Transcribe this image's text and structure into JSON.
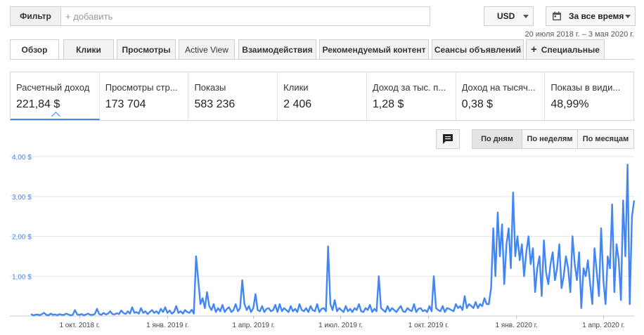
{
  "filter": {
    "button_label": "Фильтр",
    "placeholder": "+ добавить"
  },
  "currency": {
    "value": "USD"
  },
  "range": {
    "label": "За все время",
    "dates": "20 июля 2018 г. – 3 мая 2020 г."
  },
  "tabs": [
    {
      "label": "Обзор"
    },
    {
      "label": "Клики"
    },
    {
      "label": "Просмотры"
    },
    {
      "label": "Active View"
    },
    {
      "label": "Взаимодействия"
    },
    {
      "label": "Рекомендуемый контент"
    },
    {
      "label": "Сеансы объявлений"
    },
    {
      "label": "Специальные"
    }
  ],
  "metrics": [
    {
      "label": "Расчетный доход",
      "value": "221,84 $"
    },
    {
      "label": "Просмотры стр...",
      "value": "173 704"
    },
    {
      "label": "Показы",
      "value": "583 236"
    },
    {
      "label": "Клики",
      "value": "2 406"
    },
    {
      "label": "Доход за тыс. п...",
      "value": "1,28 $"
    },
    {
      "label": "Доход на тысяч...",
      "value": "0,38 $"
    },
    {
      "label": "Показы в види...",
      "value": "48,99%"
    }
  ],
  "granularity": [
    {
      "label": "По дням"
    },
    {
      "label": "По неделям"
    },
    {
      "label": "По месяцам"
    }
  ],
  "chart_data": {
    "type": "line",
    "ylim": [
      0,
      4
    ],
    "y_ticks": [
      "4,00 $",
      "3,00 $",
      "2,00 $",
      "1,00 $"
    ],
    "x_ticks": [
      "1 окт. 2018 г.",
      "1 янв. 2019 г.",
      "1 апр. 2019 г.",
      "1 июл. 2019 г.",
      "1 окт. 2019 г.",
      "1 янв. 2020 г.",
      "1 апр. 2020 г."
    ],
    "x_range": [
      "2018-07-20",
      "2020-05-03"
    ],
    "grid": true,
    "line_color": "#4285f4",
    "series": [
      {
        "values": [
          0.05,
          0.02,
          0.03,
          0.04,
          0.02,
          0.05,
          0.08,
          0.03,
          0.02,
          0.06,
          0.03,
          0.04,
          0.02,
          0.05,
          0.03,
          0.03,
          0.06,
          0.04,
          0.02,
          0.03,
          0.15,
          0.04,
          0.03,
          0.05,
          0.02,
          0.04,
          0.06,
          0.03,
          0.03,
          0.05,
          0.18,
          0.05,
          0.03,
          0.08,
          0.04,
          0.06,
          0.12,
          0.05,
          0.04,
          0.07,
          0.05,
          0.14,
          0.08,
          0.05,
          0.12,
          0.06,
          0.22,
          0.08,
          0.1,
          0.06,
          0.2,
          0.08,
          0.12,
          0.05,
          0.1,
          0.15,
          0.08,
          0.12,
          0.06,
          0.18,
          0.1,
          0.22,
          0.08,
          0.14,
          0.06,
          0.1,
          0.25,
          0.08,
          0.12,
          0.06,
          0.15,
          0.1,
          0.08,
          0.16,
          0.06,
          1.5,
          0.9,
          0.3,
          0.45,
          0.2,
          0.6,
          0.25,
          0.15,
          0.3,
          0.1,
          0.2,
          0.12,
          0.28,
          0.1,
          0.18,
          0.22,
          0.1,
          0.15,
          0.3,
          0.12,
          0.2,
          0.9,
          0.3,
          0.15,
          0.25,
          0.1,
          0.2,
          0.55,
          0.15,
          0.12,
          0.25,
          0.1,
          0.18,
          0.2,
          0.12,
          0.15,
          0.28,
          0.1,
          0.3,
          0.12,
          0.2,
          0.15,
          0.1,
          0.25,
          0.12,
          0.18,
          0.1,
          0.3,
          0.15,
          0.12,
          0.2,
          0.1,
          0.25,
          0.15,
          0.12,
          0.3,
          0.1,
          0.18,
          0.2,
          0.12,
          1.75,
          0.3,
          0.15,
          0.4,
          0.12,
          0.2,
          0.15,
          0.1,
          0.25,
          0.12,
          0.18,
          0.1,
          0.2,
          0.15,
          0.3,
          0.12,
          0.1,
          0.2,
          0.15,
          0.28,
          0.1,
          0.18,
          0.12,
          1.0,
          0.2,
          0.15,
          0.1,
          0.25,
          0.12,
          0.2,
          0.15,
          0.1,
          0.18,
          0.25,
          0.12,
          0.1,
          0.2,
          0.15,
          0.12,
          0.3,
          0.1,
          0.18,
          0.2,
          0.12,
          0.15,
          0.1,
          0.25,
          0.12,
          1.0,
          0.2,
          0.15,
          0.12,
          0.25,
          0.1,
          0.2,
          0.18,
          0.15,
          0.12,
          0.3,
          0.2,
          0.25,
          0.15,
          0.5,
          0.2,
          0.3,
          0.25,
          0.2,
          0.35,
          0.2,
          0.3,
          0.25,
          0.45,
          0.3,
          0.3,
          0.7,
          2.2,
          1.0,
          2.6,
          1.5,
          2.3,
          0.8,
          1.8,
          2.2,
          1.2,
          3.1,
          1.5,
          2.0,
          1.4,
          1.8,
          1.0,
          1.6,
          2.0,
          1.3,
          1.7,
          0.6,
          1.2,
          1.5,
          0.5,
          1.9,
          1.1,
          0.8,
          1.3,
          1.6,
          0.9,
          1.2,
          1.8,
          0.7,
          1.0,
          1.5,
          1.2,
          0.6,
          2.0,
          1.3,
          0.9,
          1.6,
          0.2,
          1.2,
          1.0,
          1.4,
          0.8,
          0.3,
          1.7,
          1.1,
          0.5,
          2.2,
          0.9,
          0.3,
          1.5,
          1.2,
          2.8,
          0.6,
          1.8,
          1.4,
          0.4,
          2.9,
          1.5,
          3.8,
          0.3,
          2.5,
          2.9
        ]
      }
    ]
  }
}
